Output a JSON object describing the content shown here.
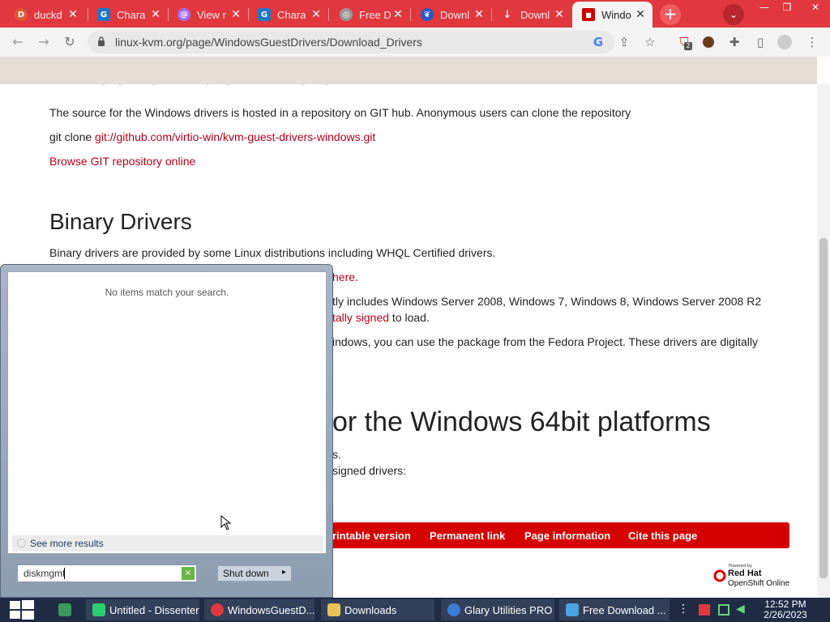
{
  "browser": {
    "tabs": [
      {
        "title": "duckd",
        "favicon_color": "#de5833",
        "favicon_glyph": "D"
      },
      {
        "title": "Chara",
        "favicon_color": "#1f77c8",
        "favicon_glyph": "G"
      },
      {
        "title": "View r",
        "favicon_color": "#a36bf5",
        "favicon_glyph": "@"
      },
      {
        "title": "Chara",
        "favicon_color": "#1f77c8",
        "favicon_glyph": "G"
      },
      {
        "title": "Free D",
        "favicon_color": "#999999",
        "favicon_glyph": "◎"
      },
      {
        "title": "Downl",
        "favicon_color": "#2c57c5",
        "favicon_glyph": "❦"
      },
      {
        "title": "Downl",
        "favicon_color": "#e0383e",
        "favicon_glyph": "↓"
      },
      {
        "title": "Windo",
        "favicon_color": "#cc0000",
        "favicon_glyph": "■"
      }
    ],
    "url": "linux-kvm.org/page/WindowsGuestDrivers/Download_Drivers",
    "extension_badge": "2"
  },
  "page": {
    "title_partial": "Windows VirtIO Drivers",
    "p1": "The source for the Windows drivers is hosted in a repository on GIT hub. Anonymous users can clone the repository",
    "p2_prefix": "git clone ",
    "p2_link": "git://github.com/virtio-win/kvm-guest-drivers-windows.git",
    "p3_link": "Browse GIT repository online",
    "h2_binary": "Binary Drivers",
    "p4": "Binary drivers are provided by some Linux distributions including WHQL Certified drivers.",
    "p5_link": "here.",
    "p6a": "tly includes Windows Server 2008, Windows 7, Windows 8, Windows Server 2008 R2",
    "p6b_link": "tally signed",
    "p6b_suffix": " to load.",
    "p7": "indows, you can use the package from the Fedora Project. These drivers are digitally",
    "h2_64bit": "or the Windows 64bit platforms",
    "p8": "s.",
    "p9": "signed drivers:",
    "footer_links": [
      "rintable version",
      "Permanent link",
      "Page information",
      "Cite this page"
    ],
    "redhat_line1": "Powered by",
    "redhat_line2": "Red Hat",
    "redhat_line3": "OpenShift Online"
  },
  "startmenu": {
    "no_items": "No items match your search.",
    "see_more": "See more results",
    "search_value": "diskmgmt",
    "clear_glyph": "×",
    "shutdown_label": "Shut down",
    "shutdown_arrow": "▸"
  },
  "taskbar": {
    "items": [
      {
        "label": "Untitled - Dissenter",
        "icon_color": "#2ecc71"
      },
      {
        "label": "WindowsGuestD...",
        "icon_color": "#e0383e"
      },
      {
        "label": "Downloads",
        "icon_color": "#e7c35a"
      },
      {
        "label": "Glary Utilities PRO",
        "icon_color": "#3a7bd5"
      },
      {
        "label": "Free Download ...",
        "icon_color": "#4aa3df"
      }
    ],
    "time": "12:52 PM",
    "date": "2/26/2023"
  }
}
